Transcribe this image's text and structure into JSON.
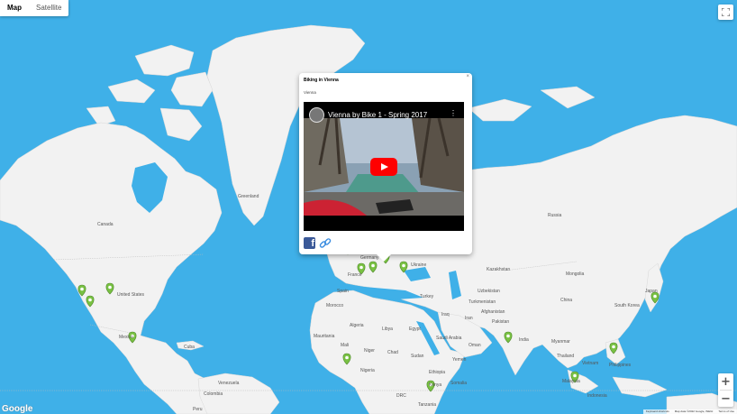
{
  "map_type": {
    "map": "Map",
    "satellite": "Satellite",
    "selected": "Map"
  },
  "controls": {
    "zoom_in": "+",
    "zoom_out": "−"
  },
  "google_logo": "Google",
  "attribution": {
    "shortcuts": "Keyboard shortcuts",
    "data": "Map data ©2022 Google, INEGI",
    "terms": "Terms of Use"
  },
  "info_window": {
    "title": "Biking in Vienna",
    "subtitle": "Vienna",
    "video_title": "Vienna by Bike 1 - Spring 2017",
    "close": "×"
  },
  "colors": {
    "water": "#3fb0e8",
    "land": "#f2f2f2",
    "marker": "#79c143",
    "youtube": "#ff0000",
    "facebook": "#3b5998"
  },
  "labels": {
    "greenland": "Greenland",
    "canada": "Canada",
    "united_states": "United States",
    "mexico": "Mexico",
    "russia": "Russia",
    "kazakhstan": "Kazakhstan",
    "mongolia": "Mongolia",
    "china": "China",
    "india": "India",
    "japan": "Japan",
    "philippines": "Philippines",
    "thailand": "Thailand",
    "myanmar": "Myanmar",
    "afghanistan": "Afghanistan",
    "pakistan": "Pakistan",
    "iran": "Iran",
    "iraq": "Iraq",
    "saudi_arabia": "Saudi Arabia",
    "turkey": "Turkey",
    "ukraine": "Ukraine",
    "germany": "Germany",
    "france": "France",
    "spain": "Spain",
    "algeria": "Algeria",
    "libya": "Libya",
    "egypt": "Egypt",
    "mali": "Mali",
    "niger": "Niger",
    "chad": "Chad",
    "sudan": "Sudan",
    "nigeria": "Nigeria",
    "ethiopia": "Ethiopia",
    "kenya": "Kenya",
    "tanzania": "Tanzania",
    "drc": "DRC",
    "mauritania": "Mauritania",
    "morocco": "Morocco",
    "uzbekistan": "Uzbekistan",
    "turkmenistan": "Turkmenistan",
    "yemen": "Yemen",
    "oman": "Oman",
    "somalia": "Somalia",
    "cuba": "Cuba",
    "venezuela": "Venezuela",
    "colombia": "Colombia",
    "peru": "Peru",
    "vietnam": "Vietnam",
    "malaysia": "Malaysia",
    "indonesia": "Indonesia",
    "south_korea": "South Korea"
  },
  "icons": [
    "fullscreen-icon",
    "play-icon",
    "facebook-icon",
    "link-icon",
    "map-pin-icon"
  ]
}
